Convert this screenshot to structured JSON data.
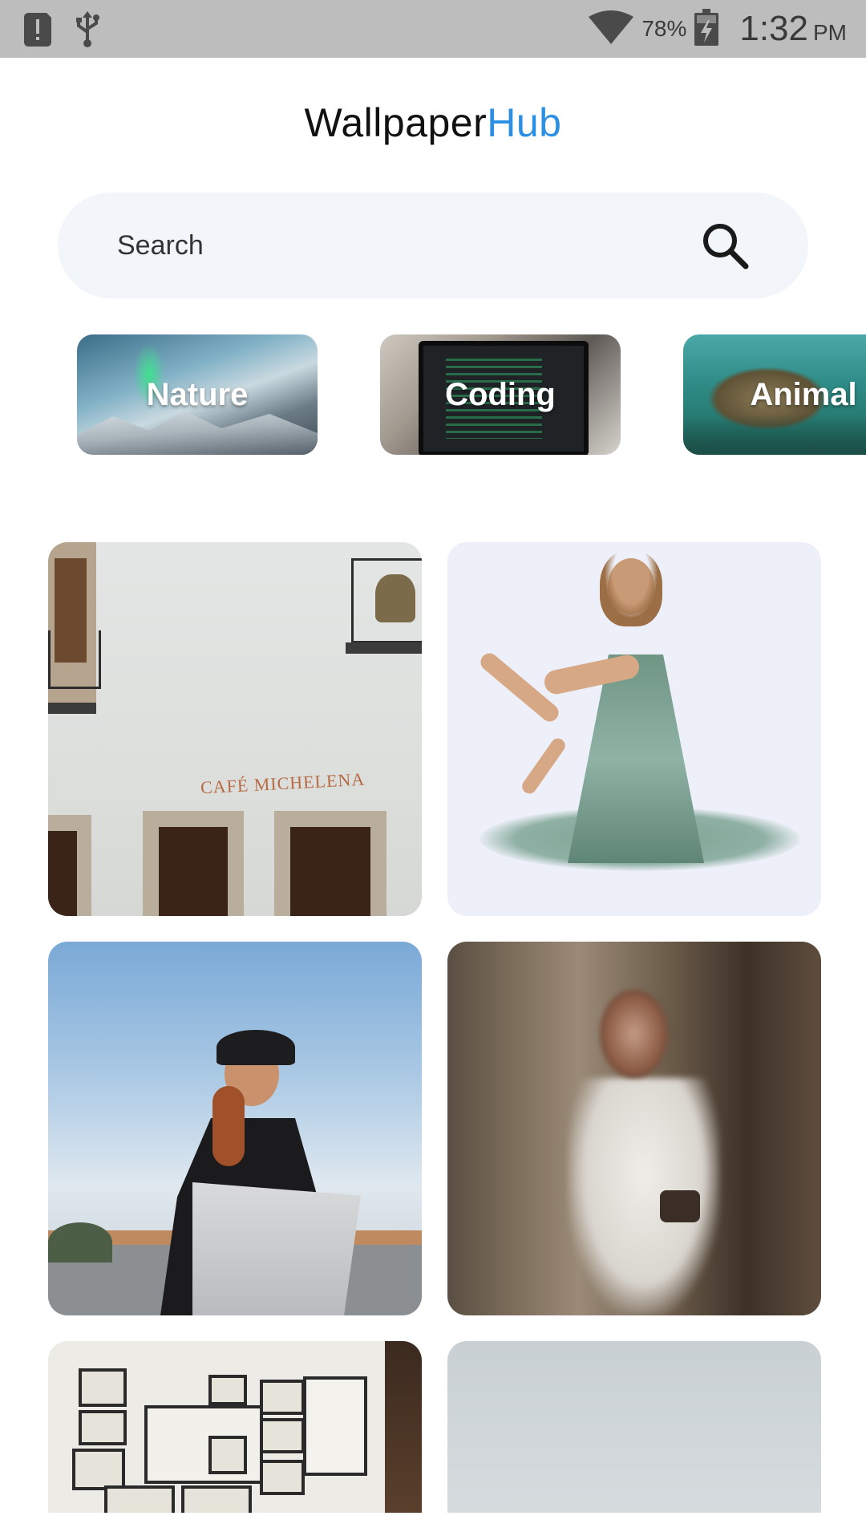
{
  "status_bar": {
    "battery_percent": "78%",
    "time": "1:32",
    "ampm": "PM",
    "icons": [
      "alert-icon",
      "usb-icon",
      "wifi-icon",
      "battery-charging-icon"
    ]
  },
  "app": {
    "title_main": "Wallpaper",
    "title_accent": "Hub",
    "accent_color": "#2b8fe3"
  },
  "search": {
    "placeholder": "Search",
    "icon": "search-icon"
  },
  "categories": [
    {
      "label": "Nature"
    },
    {
      "label": "Coding"
    },
    {
      "label": "Animal"
    }
  ],
  "wallpapers": [
    {
      "sign_text": "CAFÉ MICHELENA"
    }
  ]
}
